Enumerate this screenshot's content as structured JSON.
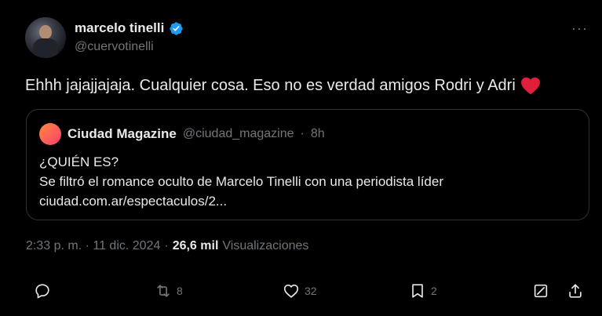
{
  "tweet": {
    "author": {
      "name": "marcelo tinelli",
      "handle": "@cuervotinelli",
      "verified_color": "#1d9bf0"
    },
    "more_label": "···",
    "text": "Ehhh jajajjajaja. Cualquier cosa. Eso no es verdad amigos Rodri y Adri",
    "quote": {
      "name": "Ciudad Magazine",
      "handle": "@ciudad_magazine",
      "dot": "·",
      "time": "8h",
      "line1": "¿QUIÉN ES?",
      "line2": "Se filtró el romance oculto de Marcelo Tinelli con una periodista líder",
      "line3": "ciudad.com.ar/espectaculos/2..."
    },
    "meta": {
      "timestamp": "2:33 p. m. · 11 dic. 2024",
      "dot": "·",
      "views": "26,6 mil",
      "views_label": "Visualizaciones"
    },
    "actions": {
      "reply_icon": "reply-icon",
      "retweet_count": "8",
      "like_count": "32",
      "bookmark_count": "2"
    },
    "colors": {
      "background": "#000000",
      "text": "#e7e9ea",
      "secondary": "#71767b",
      "border": "#2f3336",
      "heart": "#f91880"
    }
  }
}
